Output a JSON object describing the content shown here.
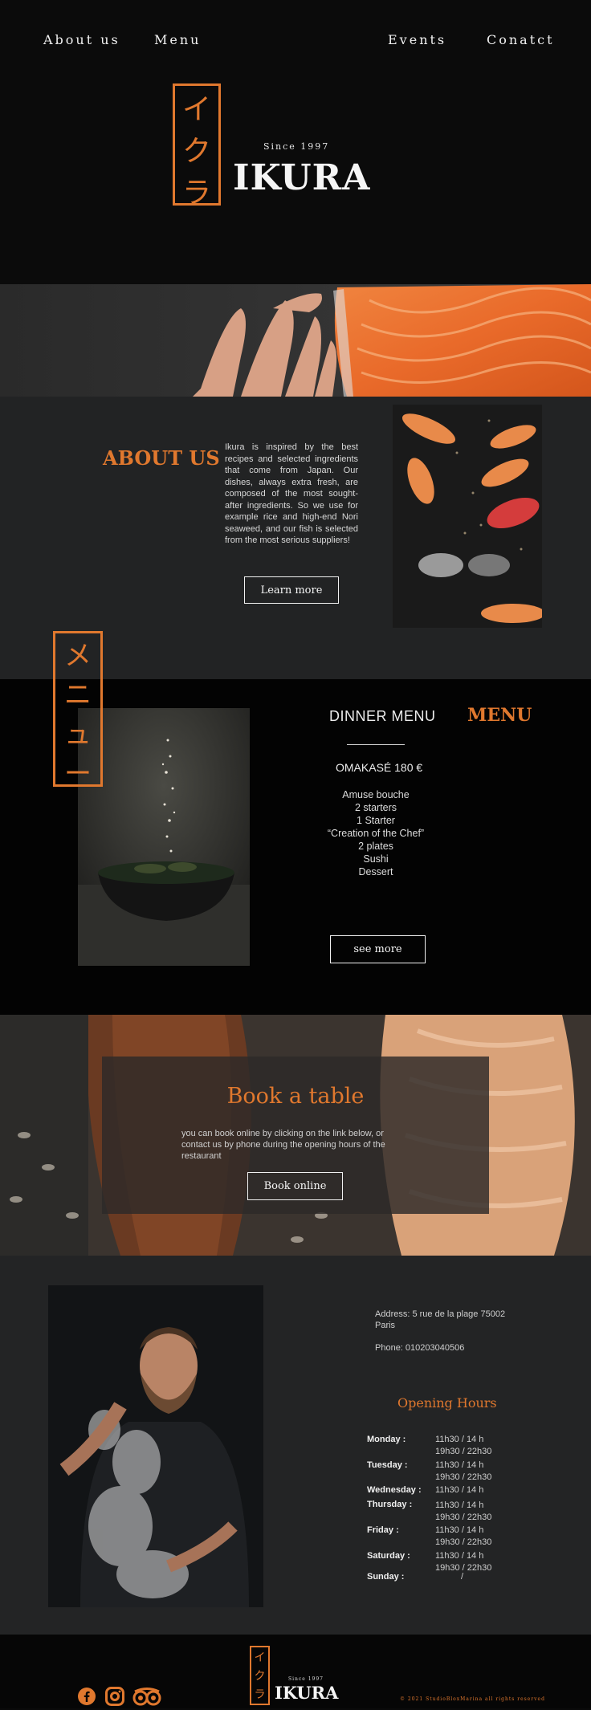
{
  "nav": {
    "about": "About us",
    "menu": "Menu",
    "events": "Events",
    "contact": "Conatct"
  },
  "brand": {
    "kanji": [
      "イ",
      "ク",
      "ラ"
    ],
    "since": "Since 1997",
    "name": "IKURA"
  },
  "about": {
    "title": "ABOUT US",
    "text": "Ikura is inspired by the best recipes and selected ingredients that come from Japan. Our dishes, always extra fresh, are composed of the most sought-after ingredients. So we use for example rice and high-end Nori seaweed, and our fish is selected from the most serious suppliers!",
    "button": "Learn more"
  },
  "menu": {
    "kanji": [
      "メ",
      "ニ",
      "ュ",
      "ー"
    ],
    "dinner_title": "DINNER MENU",
    "title": "MENU",
    "omakase": "OMAKASÉ 180 €",
    "courses": [
      "Amuse bouche",
      "2 starters",
      "1 Starter",
      "“Creation of the Chef”",
      "2 plates",
      "Sushi",
      "Dessert"
    ],
    "button": "see more"
  },
  "booking": {
    "title": "Book a table",
    "text": "you can book online by clicking on the link below, or contact us by phone during the opening hours of the restaurant",
    "button": "Book online"
  },
  "contact": {
    "address": "Address: 5 rue de la plage 75002 Paris",
    "phone": "Phone: 010203040506",
    "hours_title": "Opening Hours",
    "hours": [
      {
        "day": "Monday :",
        "times": [
          "11h30 / 14 h",
          "19h30 / 22h30"
        ]
      },
      {
        "day": "Tuesday :",
        "times": [
          "11h30 / 14 h",
          "19h30 / 22h30"
        ]
      },
      {
        "day": "Wednesday :",
        "times": [
          "11h30 / 14 h"
        ]
      },
      {
        "day": "Thursday :",
        "times": [
          "11h30 / 14 h",
          "19h30 / 22h30"
        ]
      },
      {
        "day": "Friday :",
        "times": [
          "11h30 / 14 h",
          "19h30 / 22h30"
        ]
      },
      {
        "day": "Saturday :",
        "times": [
          "11h30 / 14 h",
          "19h30 / 22h30"
        ]
      },
      {
        "day": "Sunday :",
        "times": [
          "/"
        ]
      }
    ]
  },
  "footer": {
    "kanji": [
      "イ",
      "ク",
      "ラ"
    ],
    "since": "Since 1997",
    "name": "IKURA",
    "copyright": "© 2021 StudioBloxMarina all rights reserved"
  },
  "colors": {
    "accent": "#e0782e",
    "background": "#0b0b0b",
    "panel": "#222324"
  },
  "icons": [
    "facebook-icon",
    "instagram-icon",
    "tripadvisor-icon"
  ]
}
